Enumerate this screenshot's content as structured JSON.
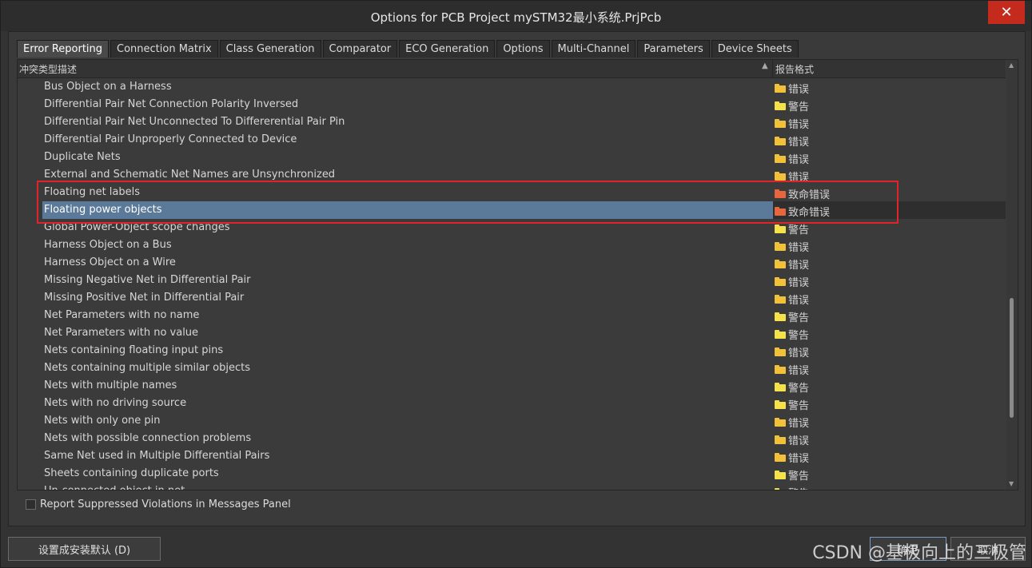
{
  "window": {
    "title": "Options for PCB Project mySTM32最小系统.PrjPcb",
    "close_label": "✕"
  },
  "tabs": [
    "Error Reporting",
    "Connection Matrix",
    "Class Generation",
    "Comparator",
    "ECO Generation",
    "Options",
    "Multi-Channel",
    "Parameters",
    "Device Sheets"
  ],
  "grid": {
    "col_description": "冲突类型描述",
    "col_report": "报告格式",
    "rows": [
      {
        "name": "Bus Object on a Harness",
        "level": "错误",
        "color": "#f2c13a"
      },
      {
        "name": "Differential Pair Net Connection Polarity Inversed",
        "level": "警告",
        "color": "#f5e24a"
      },
      {
        "name": "Differential Pair Net Unconnected To Differerential Pair Pin",
        "level": "错误",
        "color": "#f2c13a"
      },
      {
        "name": "Differential Pair Unproperly Connected to Device",
        "level": "错误",
        "color": "#f2c13a"
      },
      {
        "name": "Duplicate Nets",
        "level": "错误",
        "color": "#f2c13a"
      },
      {
        "name": "External and Schematic Net Names are Unsynchronized",
        "level": "错误",
        "color": "#f2c13a"
      },
      {
        "name": "Floating net labels",
        "level": "致命错误",
        "color": "#e8663c"
      },
      {
        "name": "Floating power objects",
        "level": "致命错误",
        "color": "#e8663c",
        "selected": true
      },
      {
        "name": "Global Power-Object scope changes",
        "level": "警告",
        "color": "#f5e24a"
      },
      {
        "name": "Harness Object on a Bus",
        "level": "错误",
        "color": "#f2c13a"
      },
      {
        "name": "Harness Object on a Wire",
        "level": "错误",
        "color": "#f2c13a"
      },
      {
        "name": "Missing Negative Net in Differential Pair",
        "level": "错误",
        "color": "#f2c13a"
      },
      {
        "name": "Missing Positive Net in Differential Pair",
        "level": "错误",
        "color": "#f2c13a"
      },
      {
        "name": "Net Parameters with no name",
        "level": "警告",
        "color": "#f5e24a"
      },
      {
        "name": "Net Parameters with no value",
        "level": "警告",
        "color": "#f5e24a"
      },
      {
        "name": "Nets containing floating input pins",
        "level": "错误",
        "color": "#f2c13a"
      },
      {
        "name": "Nets containing multiple similar objects",
        "level": "错误",
        "color": "#f2c13a"
      },
      {
        "name": "Nets with multiple names",
        "level": "警告",
        "color": "#f5e24a"
      },
      {
        "name": "Nets with no driving source",
        "level": "警告",
        "color": "#f5e24a"
      },
      {
        "name": "Nets with only one pin",
        "level": "错误",
        "color": "#f2c13a"
      },
      {
        "name": "Nets with possible connection problems",
        "level": "错误",
        "color": "#f2c13a"
      },
      {
        "name": "Same Net used in Multiple Differential Pairs",
        "level": "错误",
        "color": "#f2c13a"
      },
      {
        "name": "Sheets containing duplicate ports",
        "level": "警告",
        "color": "#f5e24a"
      },
      {
        "name": "Un-connected object in net",
        "level": "警告",
        "color": "#f5e24a"
      }
    ]
  },
  "options": {
    "report_suppressed_label": "Report Suppressed Violations in Messages Panel"
  },
  "buttons": {
    "set_default": "设置成安装默认 (D)",
    "ok": "确定",
    "cancel": "取消"
  },
  "watermark": "CSDN @基极向上的三极管"
}
